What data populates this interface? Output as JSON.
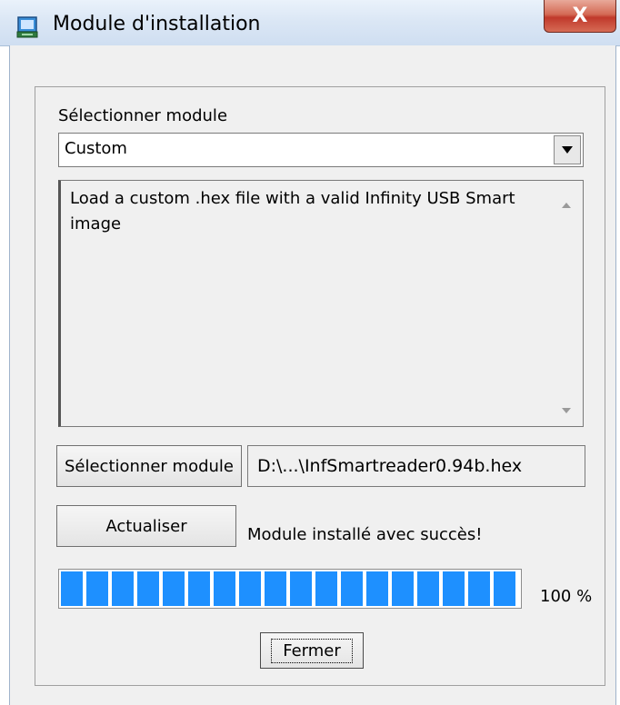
{
  "window": {
    "title": "Module d'installation",
    "close_glyph": "X",
    "icon": "installer-app-icon"
  },
  "module_select": {
    "label": "Sélectionner module",
    "selected": "Custom",
    "dropdown_icon": "dropdown-arrow-icon"
  },
  "description": {
    "text": "Load a custom .hex file with a valid Infinity USB Smart image"
  },
  "file": {
    "button_label": "Sélectionner module",
    "path": "D:\\...\\InfSmartreader0.94b.hex"
  },
  "update": {
    "button_label": "Actualiser",
    "status": "Module installé avec succès!"
  },
  "progress": {
    "value": 1.0,
    "label": "100 %",
    "color": "#1e90ff"
  },
  "footer": {
    "close_label": "Fermer"
  },
  "colors": {
    "titlebar": "#dbe7f5",
    "close_button": "#c0392b",
    "dialog_bg": "#f0f0f0"
  }
}
